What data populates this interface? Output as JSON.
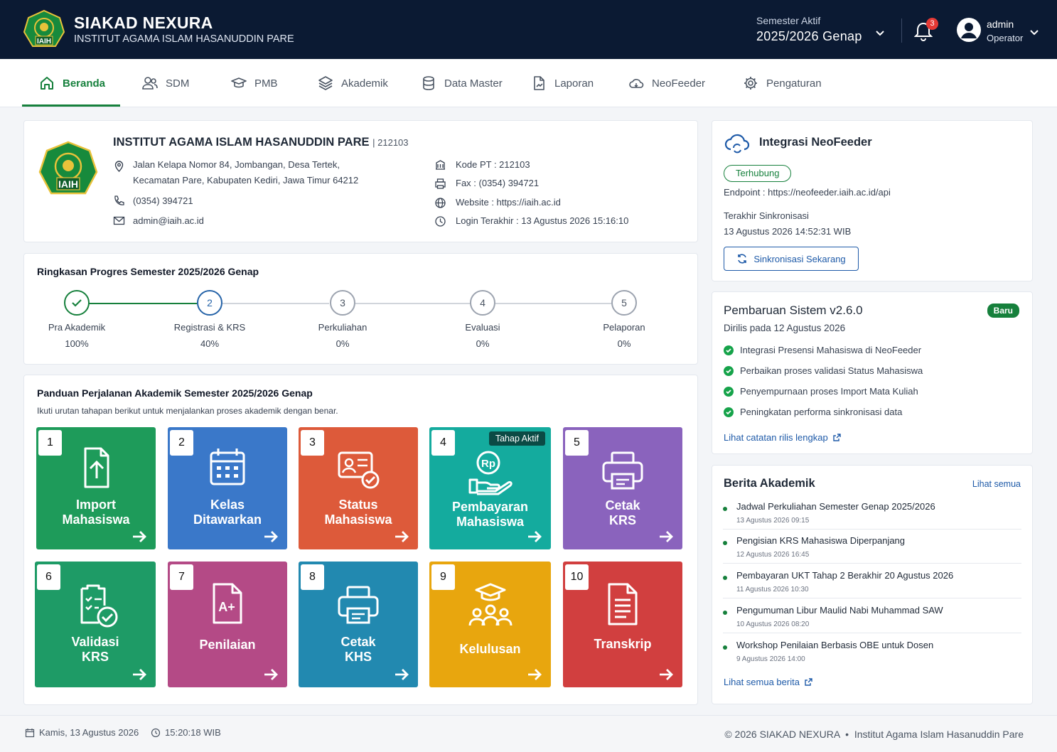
{
  "app": {
    "title": "SIAKAD NEXURA",
    "subtitle": "INSTITUT AGAMA ISLAM HASANUDDIN PARE",
    "logo_text": "IAIH"
  },
  "topbar": {
    "semester_label": "Semester Aktif",
    "semester_value": "2025/2026 Genap",
    "notification_count": "3",
    "user_name": "admin",
    "user_role": "Operator"
  },
  "nav": {
    "items": [
      {
        "label": "Beranda",
        "icon": "home-icon",
        "active": true
      },
      {
        "label": "SDM",
        "icon": "users-icon"
      },
      {
        "label": "PMB",
        "icon": "graduation-cap-icon"
      },
      {
        "label": "Akademik",
        "icon": "layers-icon"
      },
      {
        "label": "Data Master",
        "icon": "database-icon"
      },
      {
        "label": "Laporan",
        "icon": "report-icon"
      },
      {
        "label": "NeoFeeder",
        "icon": "cloud-icon"
      },
      {
        "label": "Pengaturan",
        "icon": "gear-icon"
      }
    ]
  },
  "institution": {
    "name": "INSTITUT AGAMA ISLAM HASANUDDIN PARE",
    "code": "| 212103",
    "address_1": "Jalan Kelapa Nomor 84, Jombangan, Desa Tertek,",
    "address_2": "Kecamatan Pare, Kabupaten Kediri, Jawa Timur 64212",
    "phone": "(0354) 394721",
    "email": "admin@iaih.ac.id",
    "kode_pt": "Kode PT : 212103",
    "fax": "Fax : (0354) 394721",
    "website": "Website : https://iaih.ac.id",
    "last_login": "Login Terakhir : 13 Agustus 2026 15:16:10"
  },
  "progress": {
    "title": "Ringkasan Progres Semester 2025/2026 Genap",
    "steps": [
      {
        "num": "✓",
        "label": "Pra Akademik",
        "pct": "100%",
        "state": "done"
      },
      {
        "num": "2",
        "label": "Registrasi & KRS",
        "pct": "40%",
        "state": "current"
      },
      {
        "num": "3",
        "label": "Perkuliahan",
        "pct": "0%",
        "state": "pending"
      },
      {
        "num": "4",
        "label": "Evaluasi",
        "pct": "0%",
        "state": "pending"
      },
      {
        "num": "5",
        "label": "Pelaporan",
        "pct": "0%",
        "state": "pending"
      }
    ]
  },
  "guide": {
    "title": "Panduan Perjalanan Akademik Semester 2025/2026 Genap",
    "subtitle": "Ikuti urutan tahapan berikut untuk menjalankan proses akademik dengan benar.",
    "tiles": [
      {
        "num": "1",
        "line1": "Import",
        "line2": "Mahasiswa",
        "color": "#1e9b5a",
        "icon": "upload-icon"
      },
      {
        "num": "2",
        "line1": "Kelas",
        "line2": "Ditawarkan",
        "color": "#3a78c9",
        "icon": "calendar-icon"
      },
      {
        "num": "3",
        "line1": "Status",
        "line2": "Mahasiswa",
        "color": "#dd5a3a",
        "icon": "id-card-check-icon"
      },
      {
        "num": "4",
        "line1": "Pembayaran",
        "line2": "Mahasiswa",
        "color": "#14ab9e",
        "icon": "payment-hand-icon",
        "badge": "Tahap Aktif"
      },
      {
        "num": "5",
        "line1": "Cetak",
        "line2": "KRS",
        "color": "#8a63bd",
        "icon": "printer-icon"
      },
      {
        "num": "6",
        "line1": "Validasi",
        "line2": "KRS",
        "color": "#1e9b66",
        "icon": "clipboard-check-icon"
      },
      {
        "num": "7",
        "line1": "Penilaian",
        "line2": "",
        "color": "#b44a86",
        "icon": "grade-doc-icon"
      },
      {
        "num": "8",
        "line1": "Cetak",
        "line2": "KHS",
        "color": "#2289b0",
        "icon": "printer-icon"
      },
      {
        "num": "9",
        "line1": "Kelulusan",
        "line2": "",
        "color": "#e8a60e",
        "icon": "graduates-icon"
      },
      {
        "num": "10",
        "line1": "Transkrip",
        "line2": "",
        "color": "#d13f3f",
        "icon": "transcript-icon"
      }
    ]
  },
  "neofeeder": {
    "title": "Integrasi NeoFeeder",
    "status": "Terhubung",
    "endpoint": "Endpoint : https://neofeeder.iaih.ac.id/api",
    "last_sync_label": "Terakhir Sinkronisasi",
    "last_sync_value": "13 Agustus 2026 14:52:31 WIB",
    "sync_button": "Sinkronisasi Sekarang"
  },
  "update": {
    "title": "Pembaruan Sistem v2.6.0",
    "badge": "Baru",
    "released": "Dirilis pada 12 Agustus 2026",
    "items": [
      "Integrasi Presensi Mahasiswa di NeoFeeder",
      "Perbaikan proses validasi Status Mahasiswa",
      "Penyempurnaan proses Import Mata Kuliah",
      "Peningkatan performa sinkronisasi data"
    ],
    "link": "Lihat catatan rilis lengkap"
  },
  "news": {
    "title": "Berita Akademik",
    "see_all": "Lihat semua",
    "items": [
      {
        "title": "Jadwal Perkuliahan Semester Genap 2025/2026",
        "date": "13 Agustus 2026 09:15"
      },
      {
        "title": "Pengisian KRS Mahasiswa Diperpanjang",
        "date": "12 Agustus 2026 16:45"
      },
      {
        "title": "Pembayaran UKT Tahap 2 Berakhir 20 Agustus 2026",
        "date": "11 Agustus 2026 10:30"
      },
      {
        "title": "Pengumuman Libur Maulid Nabi Muhammad SAW",
        "date": "10 Agustus 2026 08:20"
      },
      {
        "title": "Workshop Penilaian Berbasis OBE untuk Dosen",
        "date": "9 Agustus 2026 14:00"
      }
    ],
    "footer_link": "Lihat semua berita"
  },
  "footer": {
    "date": "Kamis, 13 Agustus 2026",
    "time": "15:20:18 WIB",
    "copyright": "© 2026 SIAKAD NEXURA  •  Institut Agama Islam Hasanuddin Pare"
  }
}
